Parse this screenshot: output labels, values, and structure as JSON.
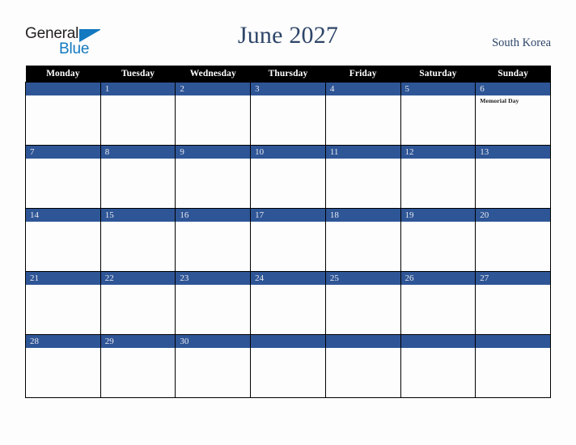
{
  "brand": {
    "name_part1": "General",
    "name_part2": "Blue",
    "triangle_icon": "blue-triangle-icon",
    "color_dark": "#231f20",
    "color_blue": "#1379c1"
  },
  "header": {
    "title": "June 2027",
    "month": "June",
    "year": "2027",
    "country": "South Korea",
    "title_color": "#2e4568"
  },
  "calendar": {
    "weekday_headers": [
      "Monday",
      "Tuesday",
      "Wednesday",
      "Thursday",
      "Friday",
      "Saturday",
      "Sunday"
    ],
    "header_bg": "#000000",
    "header_text_color": "#ffffff",
    "daybar_bg": "#2e5596",
    "daybar_text_color": "#e8eaef",
    "cell_bg": "#fdfdfd",
    "border_color": "#000000",
    "weeks": [
      [
        {
          "date": "",
          "events": []
        },
        {
          "date": "1",
          "events": []
        },
        {
          "date": "2",
          "events": []
        },
        {
          "date": "3",
          "events": []
        },
        {
          "date": "4",
          "events": []
        },
        {
          "date": "5",
          "events": []
        },
        {
          "date": "6",
          "events": [
            "Memorial Day"
          ]
        }
      ],
      [
        {
          "date": "7",
          "events": []
        },
        {
          "date": "8",
          "events": []
        },
        {
          "date": "9",
          "events": []
        },
        {
          "date": "10",
          "events": []
        },
        {
          "date": "11",
          "events": []
        },
        {
          "date": "12",
          "events": []
        },
        {
          "date": "13",
          "events": []
        }
      ],
      [
        {
          "date": "14",
          "events": []
        },
        {
          "date": "15",
          "events": []
        },
        {
          "date": "16",
          "events": []
        },
        {
          "date": "17",
          "events": []
        },
        {
          "date": "18",
          "events": []
        },
        {
          "date": "19",
          "events": []
        },
        {
          "date": "20",
          "events": []
        }
      ],
      [
        {
          "date": "21",
          "events": []
        },
        {
          "date": "22",
          "events": []
        },
        {
          "date": "23",
          "events": []
        },
        {
          "date": "24",
          "events": []
        },
        {
          "date": "25",
          "events": []
        },
        {
          "date": "26",
          "events": []
        },
        {
          "date": "27",
          "events": []
        }
      ],
      [
        {
          "date": "28",
          "events": []
        },
        {
          "date": "29",
          "events": []
        },
        {
          "date": "30",
          "events": []
        },
        {
          "date": "",
          "events": []
        },
        {
          "date": "",
          "events": []
        },
        {
          "date": "",
          "events": []
        },
        {
          "date": "",
          "events": []
        }
      ]
    ]
  }
}
